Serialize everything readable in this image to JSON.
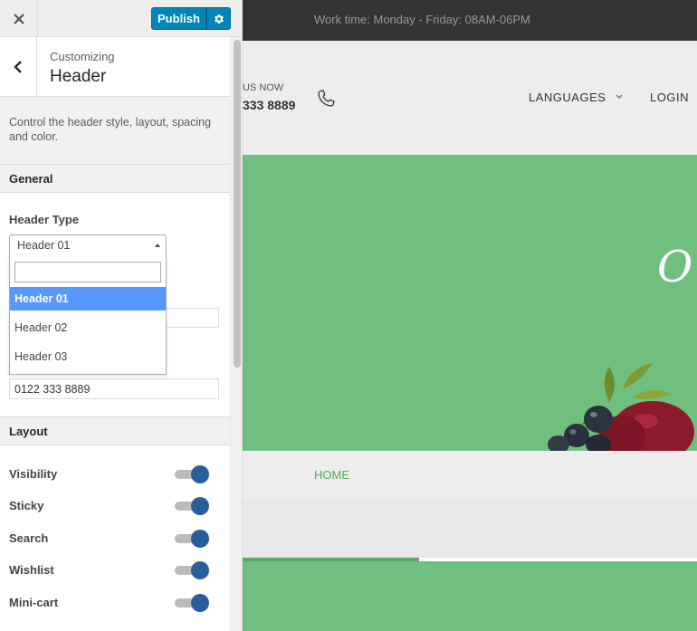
{
  "toolbar": {
    "publish_label": "Publish"
  },
  "section": {
    "customizing_label": "Customizing",
    "title": "Header",
    "description": "Control the header style, layout, spacing and color."
  },
  "general": {
    "heading": "General",
    "header_type": {
      "label": "Header Type",
      "selected": "Header 01",
      "search_value": "",
      "options": [
        "Header 01",
        "Header 02",
        "Header 03"
      ]
    },
    "phone_value": "0122 333 8889"
  },
  "layout": {
    "heading": "Layout",
    "toggles": [
      {
        "label": "Visibility",
        "on": true
      },
      {
        "label": "Sticky",
        "on": true
      },
      {
        "label": "Search",
        "on": true
      },
      {
        "label": "Wishlist",
        "on": true
      },
      {
        "label": "Mini-cart",
        "on": true
      }
    ]
  },
  "preview": {
    "worktime": "Work time: Monday - Friday: 08AM-06PM",
    "call_label": "US NOW",
    "call_number": "333 8889",
    "languages": "LANGUAGES",
    "login": "LOGIN",
    "hero_script": "O",
    "nav_home": "HOME"
  },
  "colors": {
    "publish": "#0085ba",
    "hero_green": "#6fc07e",
    "toggle_on": "#2a5d9b",
    "dropdown_selected": "#5897fb",
    "nav_active": "#4caf50"
  }
}
